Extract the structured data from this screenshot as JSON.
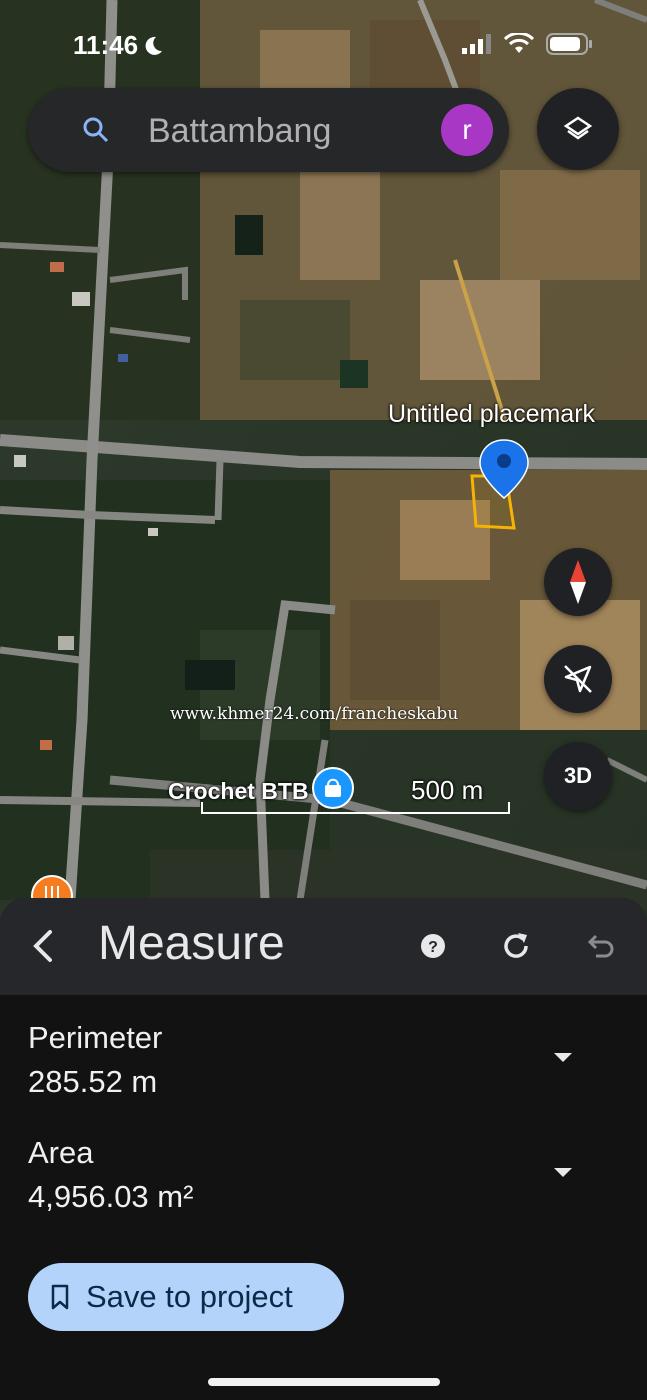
{
  "status_bar": {
    "time": "11:46"
  },
  "search": {
    "placeholder": "Battambang",
    "avatar_letter": "r"
  },
  "map": {
    "placemark_label": "Untitled placemark",
    "poi_label": "Crochet BTB",
    "scale_label": "500 m",
    "watermark": "www.khmer24.com/francheskabu",
    "view_3d_label": "3D"
  },
  "measure": {
    "title": "Measure",
    "perimeter": {
      "label": "Perimeter",
      "value": "285.52 m"
    },
    "area": {
      "label": "Area",
      "value": "4,956.03 m²"
    },
    "save_label": "Save to project"
  },
  "colors": {
    "accent": "#b3d3fb",
    "pin": "#1a73e8",
    "polygon": "#f6b400",
    "avatar": "#a837c6"
  }
}
